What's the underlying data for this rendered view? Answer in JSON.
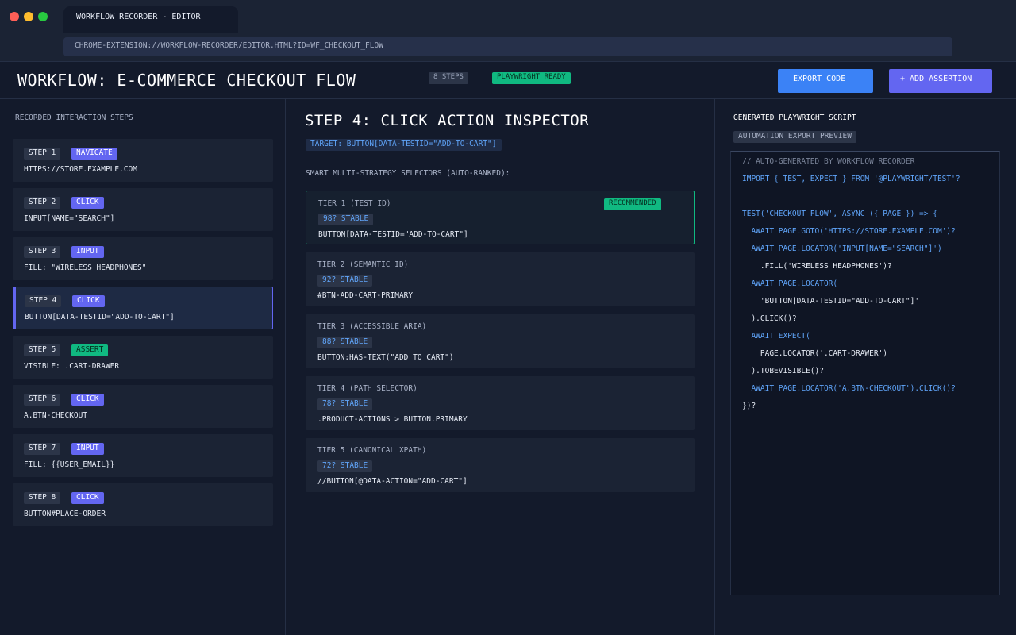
{
  "window": {
    "tab_title": "WORKFLOW RECORDER - EDITOR",
    "url": "CHROME-EXTENSION://WORKFLOW-RECORDER/EDITOR.HTML?ID=WF_CHECKOUT_FLOW"
  },
  "header": {
    "title": "WORKFLOW: E-COMMERCE CHECKOUT FLOW",
    "steps_badge": "8 STEPS",
    "status_badge": "PLAYWRIGHT READY",
    "export_label": "EXPORT CODE",
    "add_assertion_label": "+ ADD ASSERTION"
  },
  "steps_panel": {
    "heading": "RECORDED INTERACTION STEPS",
    "active_step": 4,
    "steps": [
      {
        "label": "STEP 1",
        "type": "NAVIGATE",
        "detail": "HTTPS://STORE.EXAMPLE.COM"
      },
      {
        "label": "STEP 2",
        "type": "CLICK",
        "detail": "INPUT[NAME=\"SEARCH\"]"
      },
      {
        "label": "STEP 3",
        "type": "INPUT",
        "detail": "FILL: \"WIRELESS HEADPHONES\""
      },
      {
        "label": "STEP 4",
        "type": "CLICK",
        "detail": "BUTTON[DATA-TESTID=\"ADD-TO-CART\"]"
      },
      {
        "label": "STEP 5",
        "type": "ASSERT",
        "detail": "VISIBLE: .CART-DRAWER"
      },
      {
        "label": "STEP 6",
        "type": "CLICK",
        "detail": "A.BTN-CHECKOUT"
      },
      {
        "label": "STEP 7",
        "type": "INPUT",
        "detail": "FILL: {{USER_EMAIL}}"
      },
      {
        "label": "STEP 8",
        "type": "CLICK",
        "detail": "BUTTON#PLACE-ORDER"
      }
    ]
  },
  "inspector": {
    "title": "STEP 4: CLICK ACTION INSPECTOR",
    "target": "TARGET: BUTTON[DATA-TESTID=\"ADD-TO-CART\"]",
    "selectors_heading": "SMART MULTI-STRATEGY SELECTORS (AUTO-RANKED):",
    "recommended_label": "RECOMMENDED",
    "tiers": [
      {
        "name": "TIER 1 (TEST ID)",
        "stability": "98? STABLE",
        "selector": "BUTTON[DATA-TESTID=\"ADD-TO-CART\"]"
      },
      {
        "name": "TIER 2 (SEMANTIC ID)",
        "stability": "92? STABLE",
        "selector": "#BTN-ADD-CART-PRIMARY"
      },
      {
        "name": "TIER 3 (ACCESSIBLE ARIA)",
        "stability": "88? STABLE",
        "selector": "BUTTON:HAS-TEXT(\"ADD TO CART\")"
      },
      {
        "name": "TIER 4 (PATH SELECTOR)",
        "stability": "78? STABLE",
        "selector": ".PRODUCT-ACTIONS > BUTTON.PRIMARY"
      },
      {
        "name": "TIER 5 (CANONICAL XPATH)",
        "stability": "72? STABLE",
        "selector": "//BUTTON[@DATA-ACTION=\"ADD-CART\"]"
      }
    ]
  },
  "script_panel": {
    "heading": "GENERATED PLAYWRIGHT SCRIPT",
    "subheading": "AUTOMATION EXPORT PREVIEW",
    "code_lines": [
      {
        "text": "// AUTO-GENERATED BY WORKFLOW RECORDER",
        "kind": "comment"
      },
      {
        "text": "IMPORT { TEST, EXPECT } FROM '@PLAYWRIGHT/TEST'?",
        "kind": "code"
      },
      {
        "text": "",
        "kind": "code"
      },
      {
        "text": "TEST('CHECKOUT FLOW', ASYNC ({ PAGE }) => {",
        "kind": "code"
      },
      {
        "text": "  AWAIT PAGE.GOTO('HTTPS://STORE.EXAMPLE.COM')?",
        "kind": "code"
      },
      {
        "text": "  AWAIT PAGE.LOCATOR('INPUT[NAME=\"SEARCH\"]')",
        "kind": "code"
      },
      {
        "text": "    .FILL('WIRELESS HEADPHONES')?",
        "kind": "punct"
      },
      {
        "text": "  AWAIT PAGE.LOCATOR(",
        "kind": "code"
      },
      {
        "text": "    'BUTTON[DATA-TESTID=\"ADD-TO-CART\"]'",
        "kind": "punct"
      },
      {
        "text": "  ).CLICK()?",
        "kind": "punct"
      },
      {
        "text": "  AWAIT EXPECT(",
        "kind": "code"
      },
      {
        "text": "    PAGE.LOCATOR('.CART-DRAWER')",
        "kind": "punct"
      },
      {
        "text": "  ).TOBEVISIBLE()?",
        "kind": "punct"
      },
      {
        "text": "  AWAIT PAGE.LOCATOR('A.BTN-CHECKOUT').CLICK()?",
        "kind": "code"
      },
      {
        "text": "})?",
        "kind": "punct"
      }
    ]
  }
}
